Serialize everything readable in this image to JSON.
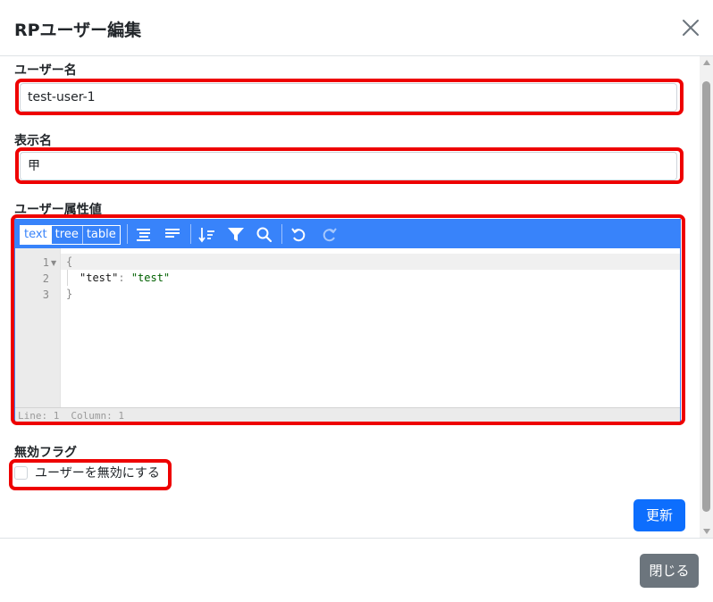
{
  "modal": {
    "title": "RPユーザー編集",
    "close_icon": "close-icon"
  },
  "form": {
    "username": {
      "label": "ユーザー名",
      "value": "test-user-1"
    },
    "display_name": {
      "label": "表示名",
      "value": "甲"
    },
    "attributes": {
      "label": "ユーザー属性値",
      "modes": [
        "text",
        "tree",
        "table"
      ],
      "active_mode": "text",
      "toolbar_icons": [
        "format-icon",
        "compact-icon",
        "sort-icon",
        "filter-icon",
        "search-icon",
        "undo-icon",
        "redo-icon"
      ],
      "line_numbers": [
        "1",
        "2",
        "3"
      ],
      "code": {
        "open_brace": "{",
        "key": "\"test\"",
        "colon": ": ",
        "value": "\"test\"",
        "close_brace": "}"
      },
      "status": {
        "line": "Line: 1",
        "column": "Column: 1"
      }
    },
    "disable_flag": {
      "label": "無効フラグ",
      "checkbox_label": "ユーザーを無効にする",
      "checked": false
    },
    "update_button": "更新"
  },
  "footer": {
    "close_button": "閉じる"
  },
  "colors": {
    "primary": "#0d6efd",
    "secondary": "#6c757d",
    "editor_accent": "#3883fa",
    "highlight": "#ee0000"
  }
}
